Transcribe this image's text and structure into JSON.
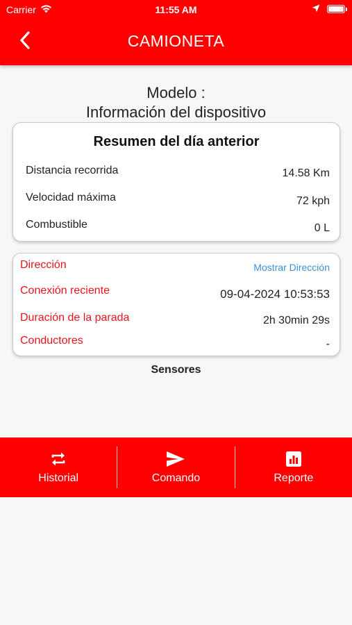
{
  "status_bar": {
    "carrier": "Carrier",
    "time": "11:55 AM"
  },
  "header": {
    "title": "CAMIONETA",
    "back_icon": "chevron-left-icon"
  },
  "model": {
    "line1": "Modelo :",
    "line2": "Información del dispositivo"
  },
  "summary": {
    "title": "Resumen del día anterior",
    "rows": [
      {
        "label": "Distancia recorrida",
        "value": "14.58 Km"
      },
      {
        "label": "Velocidad máxima",
        "value": "72 kph"
      },
      {
        "label": "Combustible",
        "value": "0 L"
      }
    ]
  },
  "info": {
    "rows": [
      {
        "label": "Dirección",
        "value": "Mostrar Dirección"
      },
      {
        "label": "Conexión reciente",
        "value": "09-04-2024 10:53:53"
      },
      {
        "label": "Duración de la parada",
        "value": "2h 30min 29s"
      },
      {
        "label": "Conductores",
        "value": "-"
      }
    ]
  },
  "sensors": {
    "label": "Sensores"
  },
  "bottom_nav": {
    "items": [
      {
        "label": "Historial",
        "icon": "repeat-icon"
      },
      {
        "label": "Comando",
        "icon": "send-icon"
      },
      {
        "label": "Reporte",
        "icon": "report-chart-icon"
      }
    ]
  },
  "colors": {
    "accent": "#ff0000",
    "label_red": "#e8141e",
    "link_blue": "#3a8fd8",
    "background": "#f7f7f7"
  }
}
